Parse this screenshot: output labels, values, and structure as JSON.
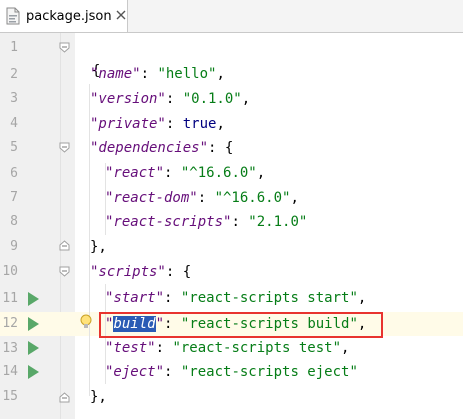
{
  "tab": {
    "title": "package.json",
    "file_icon": "json-file-icon",
    "close_icon": "close-icon"
  },
  "line_numbers": [
    "1",
    "2",
    "3",
    "4",
    "5",
    "6",
    "7",
    "8",
    "9",
    "10",
    "11",
    "12",
    "13",
    "14",
    "15"
  ],
  "code": {
    "open_brace": "{",
    "name": {
      "key": "\"name\"",
      "colon": ": ",
      "value": "\"hello\"",
      "comma": ","
    },
    "version": {
      "key": "\"version\"",
      "colon": ": ",
      "value": "\"0.1.0\"",
      "comma": ","
    },
    "private": {
      "key": "\"private\"",
      "colon": ": ",
      "value": "true",
      "comma": ","
    },
    "dependencies": {
      "key": "\"dependencies\"",
      "colon": ": ",
      "open": "{"
    },
    "react": {
      "key": "\"react\"",
      "colon": ": ",
      "value": "\"^16.6.0\"",
      "comma": ","
    },
    "react_dom": {
      "key": "\"react-dom\"",
      "colon": ": ",
      "value": "\"^16.6.0\"",
      "comma": ","
    },
    "react_scripts": {
      "key": "\"react-scripts\"",
      "colon": ": ",
      "value": "\"2.1.0\""
    },
    "close_deps": "},",
    "scripts": {
      "key": "\"scripts\"",
      "colon": ": ",
      "open": "{"
    },
    "start": {
      "key": "\"start\"",
      "colon": ": ",
      "value": "\"react-scripts start\"",
      "comma": ","
    },
    "build": {
      "quote_open": "\"",
      "key_selected": "build",
      "quote_close": "\"",
      "colon": ": ",
      "value": "\"react-scripts build\"",
      "comma": ","
    },
    "test": {
      "key": "\"test\"",
      "colon": ": ",
      "value": "\"react-scripts test\"",
      "comma": ","
    },
    "eject": {
      "key": "\"eject\"",
      "colon": ": ",
      "value": "\"react-scripts eject\""
    },
    "close_scripts": "},"
  },
  "icons": {
    "run": "run-script-icon",
    "bulb": "intention-bulb-icon",
    "fold": "fold-icon"
  },
  "colors": {
    "key": "#660e7a",
    "string": "#067d17",
    "keyword": "#000080",
    "selection": "#2b5bb5",
    "highlight_box": "#e8332f",
    "run_icon": "#59a869"
  }
}
